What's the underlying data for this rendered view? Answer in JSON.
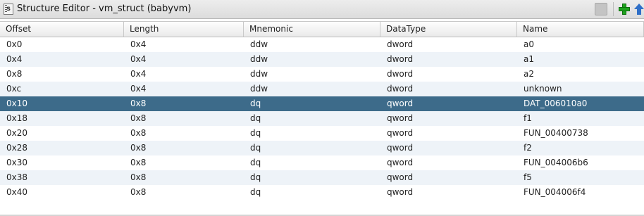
{
  "window": {
    "title": "Structure Editor - vm_struct (babyvm)",
    "icon": "structure-icon"
  },
  "toolbar": {
    "buttons": [
      {
        "name": "disabled-action-icon"
      },
      {
        "name": "add-icon",
        "color": "#1ea31e"
      },
      {
        "name": "up-arrow-icon",
        "color": "#2f6fc8"
      }
    ]
  },
  "table": {
    "columns": [
      "Offset",
      "Length",
      "Mnemonic",
      "DataType",
      "Name"
    ],
    "selected_row": 4,
    "selected_color": "#3d6b8a",
    "rows": [
      {
        "offset": "0x0",
        "length": "0x4",
        "mnemonic": "ddw",
        "datatype": "dword",
        "name": "a0"
      },
      {
        "offset": "0x4",
        "length": "0x4",
        "mnemonic": "ddw",
        "datatype": "dword",
        "name": "a1"
      },
      {
        "offset": "0x8",
        "length": "0x4",
        "mnemonic": "ddw",
        "datatype": "dword",
        "name": "a2"
      },
      {
        "offset": "0xc",
        "length": "0x4",
        "mnemonic": "ddw",
        "datatype": "dword",
        "name": "unknown"
      },
      {
        "offset": "0x10",
        "length": "0x8",
        "mnemonic": "dq",
        "datatype": "qword",
        "name": "DAT_006010a0"
      },
      {
        "offset": "0x18",
        "length": "0x8",
        "mnemonic": "dq",
        "datatype": "qword",
        "name": "f1"
      },
      {
        "offset": "0x20",
        "length": "0x8",
        "mnemonic": "dq",
        "datatype": "qword",
        "name": "FUN_00400738"
      },
      {
        "offset": "0x28",
        "length": "0x8",
        "mnemonic": "dq",
        "datatype": "qword",
        "name": "f2"
      },
      {
        "offset": "0x30",
        "length": "0x8",
        "mnemonic": "dq",
        "datatype": "qword",
        "name": "FUN_004006b6"
      },
      {
        "offset": "0x38",
        "length": "0x8",
        "mnemonic": "dq",
        "datatype": "qword",
        "name": "f5"
      },
      {
        "offset": "0x40",
        "length": "0x8",
        "mnemonic": "dq",
        "datatype": "qword",
        "name": "FUN_004006f4"
      }
    ]
  }
}
